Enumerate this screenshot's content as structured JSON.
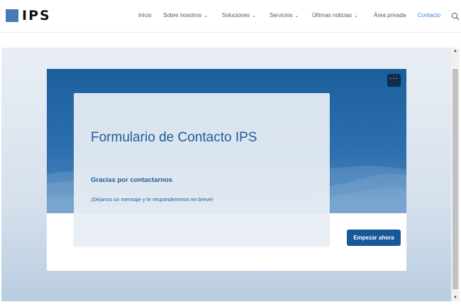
{
  "header": {
    "logo_text": "IPS",
    "nav": [
      {
        "label": "Inicio",
        "has_dropdown": false
      },
      {
        "label": "Sobre nosotros",
        "has_dropdown": true
      },
      {
        "label": "Soluciones",
        "has_dropdown": true
      },
      {
        "label": "Servicios",
        "has_dropdown": true
      },
      {
        "label": "Últimas noticias",
        "has_dropdown": true
      },
      {
        "label": "Área privada",
        "has_dropdown": false
      },
      {
        "label": "Contacto",
        "has_dropdown": false,
        "active": true
      }
    ],
    "active_color": "#2e86de"
  },
  "form": {
    "title": "Formulario de Contacto IPS",
    "subtitle": "Gracias por contactarnos",
    "message": "¡Déjanos un mensaje y te responderemos en breve!",
    "start_button_label": "Empezar ahora",
    "more_button_label": "···"
  },
  "scrollbar": {
    "up_arrow": "▲",
    "down_arrow": "▼"
  },
  "colors": {
    "brand_blue": "#1f5c99",
    "banner_blue": "#1a5f9b",
    "button_blue": "#17589a",
    "logo_square": "#4a78b8"
  }
}
